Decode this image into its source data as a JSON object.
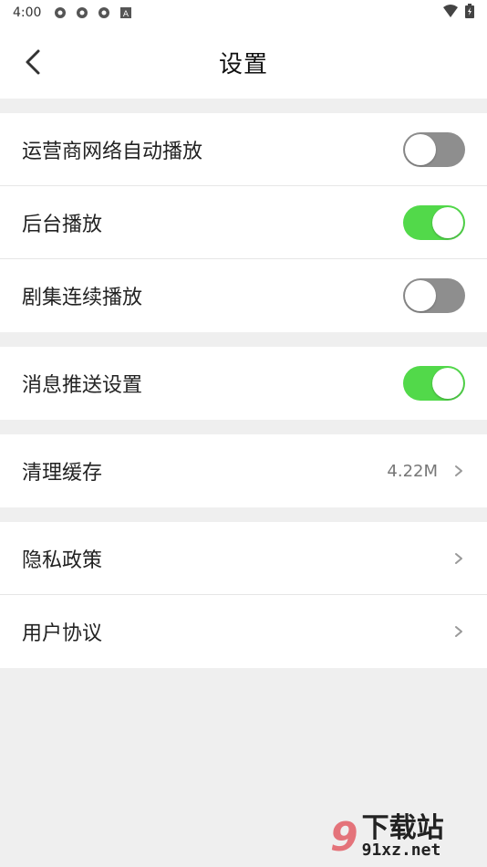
{
  "status_bar": {
    "time": "4:00",
    "icons": [
      "notification-icon",
      "notification-icon",
      "notification-icon",
      "a-icon"
    ],
    "right_icons": [
      "wifi-icon",
      "battery-icon"
    ]
  },
  "header": {
    "title": "设置",
    "back_icon": "chevron-left-icon"
  },
  "groups": [
    {
      "items": [
        {
          "label": "运营商网络自动播放",
          "type": "toggle",
          "state": "off"
        },
        {
          "label": "后台播放",
          "type": "toggle",
          "state": "on"
        },
        {
          "label": "剧集连续播放",
          "type": "toggle",
          "state": "off"
        }
      ]
    },
    {
      "items": [
        {
          "label": "消息推送设置",
          "type": "toggle",
          "state": "on"
        }
      ]
    },
    {
      "items": [
        {
          "label": "清理缓存",
          "type": "link",
          "value": "4.22M"
        }
      ]
    },
    {
      "items": [
        {
          "label": "隐私政策",
          "type": "link"
        },
        {
          "label": "用户协议",
          "type": "link"
        }
      ]
    }
  ],
  "colors": {
    "toggle_on": "#52d94a",
    "toggle_off": "#8e8e8e",
    "background": "#efefef"
  },
  "watermark": {
    "logo": "9",
    "top": "下载站",
    "bottom": "91xz.net"
  }
}
